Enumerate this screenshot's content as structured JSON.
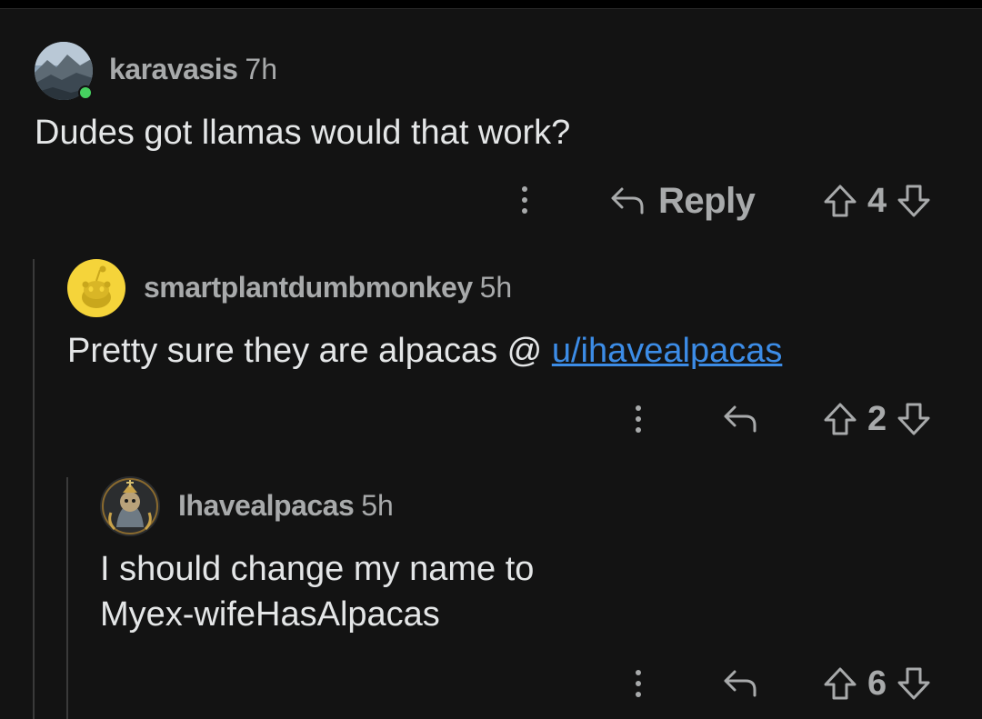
{
  "comments": [
    {
      "username": "karavasis",
      "time": "7h",
      "body": "Dudes got llamas would that work?",
      "reply_label": "Reply",
      "score": "4",
      "online": true
    },
    {
      "username": "smartplantdumbmonkey",
      "time": "5h",
      "body_prefix": "Pretty sure they are alpacas @ ",
      "mention": "u/ihavealpacas",
      "score": "2"
    },
    {
      "username": "Ihavealpacas",
      "time": "5h",
      "body_line1": "I should change my name to",
      "body_line2": "Myex-wifeHasAlpacas",
      "score": "6"
    }
  ],
  "colors": {
    "background": "#131313",
    "text_secondary": "#a8aaab",
    "link": "#3c8ce6",
    "online": "#46d160"
  },
  "icons": [
    "more-options-icon",
    "reply-arrow-icon",
    "upvote-arrow-icon",
    "downvote-arrow-icon",
    "online-indicator-icon"
  ]
}
